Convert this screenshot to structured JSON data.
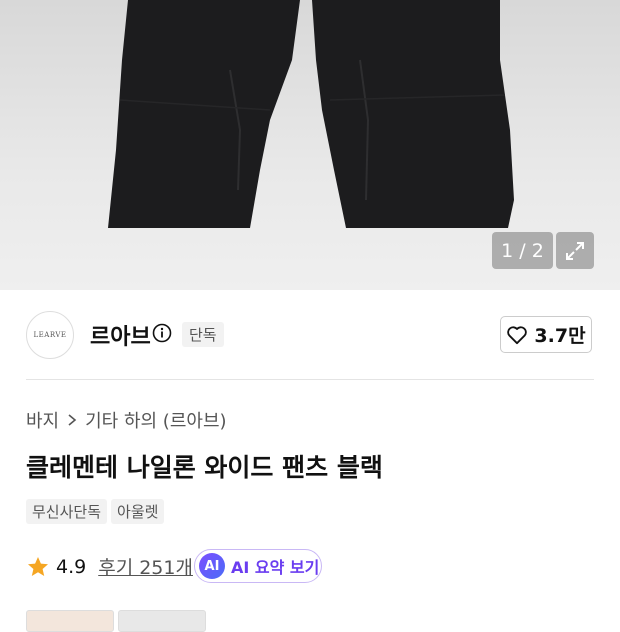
{
  "gallery": {
    "counter": "1 / 2"
  },
  "brand": {
    "logo_text": "LEARVE",
    "name": "르아브",
    "badge": "단독",
    "like_count": "3.7만"
  },
  "breadcrumb": {
    "category": "바지",
    "subcategory": "기타 하의 (르아브)"
  },
  "product": {
    "title": "클레멘테 나일론 와이드 팬츠 블랙",
    "tags": [
      "무신사단독",
      "아울렛"
    ]
  },
  "rating": {
    "score": "4.9",
    "reviews": "후기 251개"
  },
  "ai_summary": {
    "badge": "AI",
    "label": "AI 요약 보기"
  },
  "colors": {
    "accent": "#6a3df0",
    "star": "#f5a623"
  }
}
